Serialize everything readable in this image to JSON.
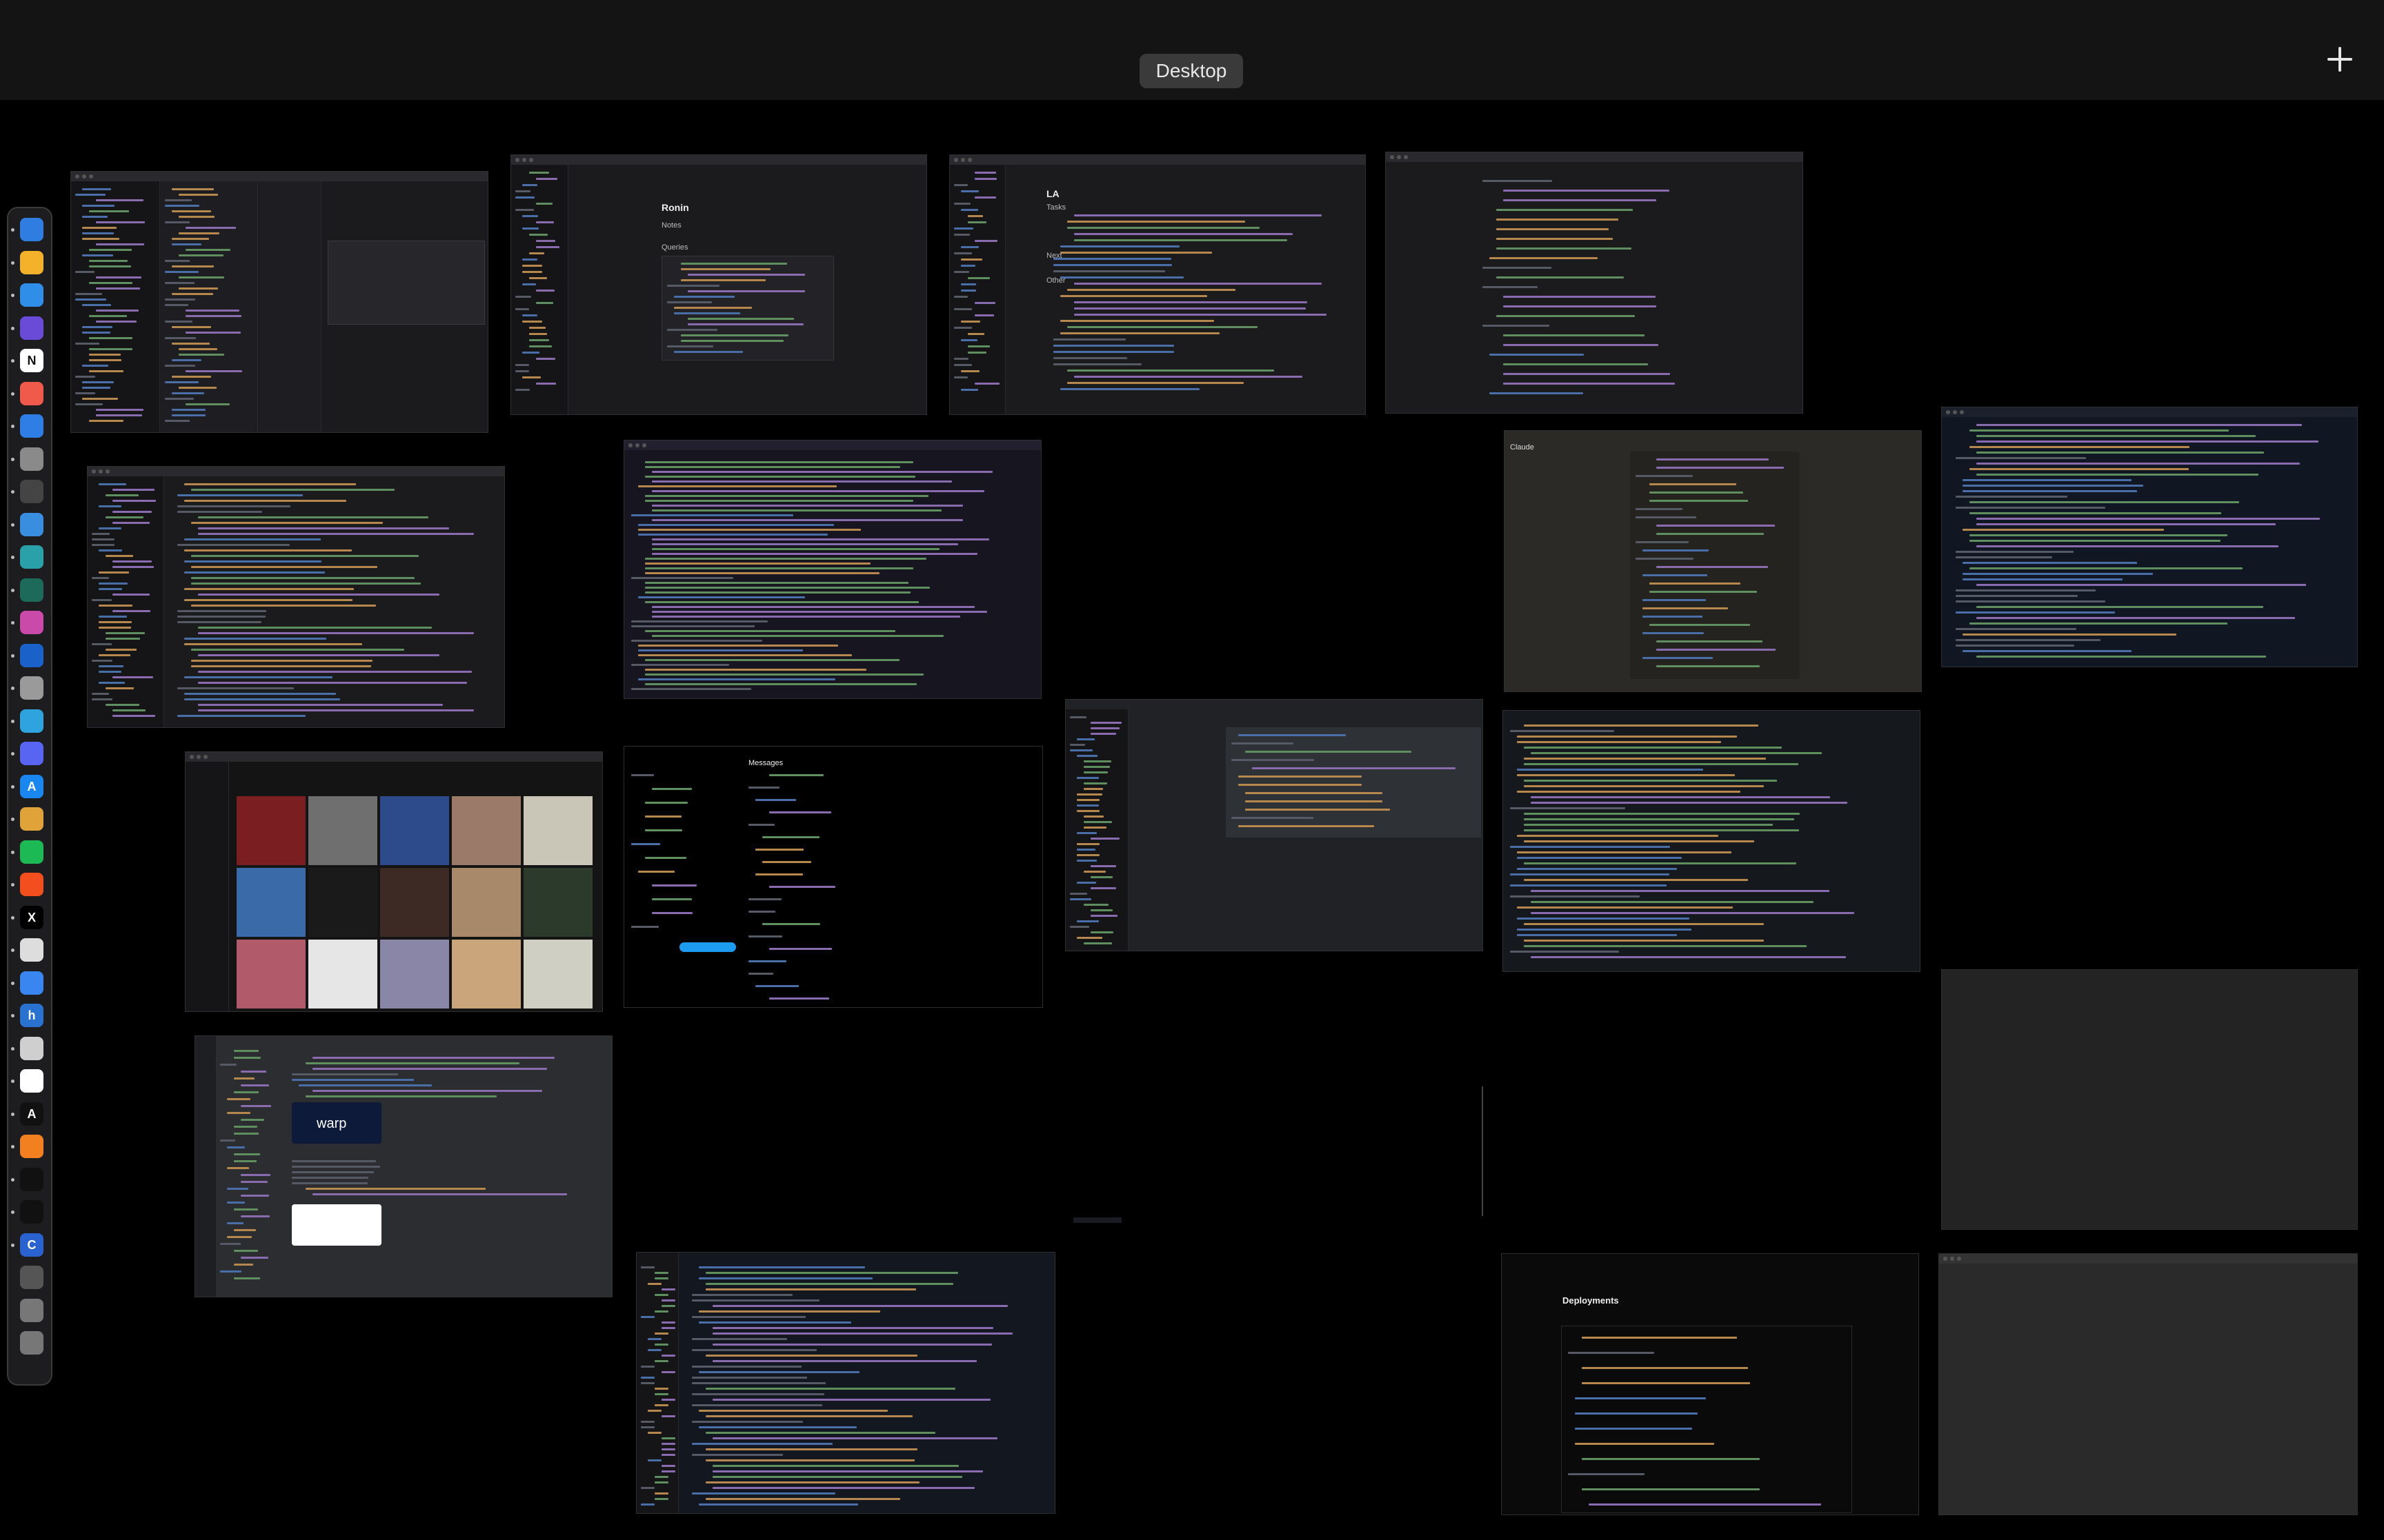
{
  "spaces": {
    "current_label": "Desktop"
  },
  "dock": {
    "apps": [
      {
        "name": "finder-icon",
        "color": "#2f7de1",
        "glyph": ""
      },
      {
        "name": "app-yellow-icon",
        "color": "#f4b12a",
        "glyph": ""
      },
      {
        "name": "safari-icon",
        "color": "#2f8fe8",
        "glyph": ""
      },
      {
        "name": "app-violet-icon",
        "color": "#6a4bd8",
        "glyph": ""
      },
      {
        "name": "notion-icon",
        "color": "#ffffff",
        "glyph": "N"
      },
      {
        "name": "calendar-icon",
        "color": "#f05a4a",
        "glyph": ""
      },
      {
        "name": "tasks-icon",
        "color": "#2e7ee6",
        "glyph": ""
      },
      {
        "name": "app-gray-icon",
        "color": "#8a8a8a",
        "glyph": ""
      },
      {
        "name": "app-box-icon",
        "color": "#444444",
        "glyph": ""
      },
      {
        "name": "app-blue-icon",
        "color": "#3a8ee0",
        "glyph": ""
      },
      {
        "name": "app-teal-icon",
        "color": "#2aa1a8",
        "glyph": ""
      },
      {
        "name": "terminal-icon",
        "color": "#1e6a5a",
        "glyph": ""
      },
      {
        "name": "app-pink-icon",
        "color": "#c94aa8",
        "glyph": ""
      },
      {
        "name": "onepassword-icon",
        "color": "#1a62c9",
        "glyph": ""
      },
      {
        "name": "preview-icon",
        "color": "#9a9a9a",
        "glyph": ""
      },
      {
        "name": "telegram-icon",
        "color": "#2ea3dd",
        "glyph": ""
      },
      {
        "name": "discord-icon",
        "color": "#5865f2",
        "glyph": ""
      },
      {
        "name": "app-store-icon",
        "color": "#1a86f0",
        "glyph": "A"
      },
      {
        "name": "slack-icon",
        "color": "#e0a33a",
        "glyph": ""
      },
      {
        "name": "spotify-icon",
        "color": "#1db954",
        "glyph": ""
      },
      {
        "name": "figma-icon",
        "color": "#f24e1e",
        "glyph": ""
      },
      {
        "name": "x-icon",
        "color": "#000000",
        "glyph": "X"
      },
      {
        "name": "app-white-icon",
        "color": "#dddddd",
        "glyph": ""
      },
      {
        "name": "chrome-icon",
        "color": "#3a86f0",
        "glyph": ""
      },
      {
        "name": "app-h-icon",
        "color": "#2a72d0",
        "glyph": "h"
      },
      {
        "name": "app-light-icon",
        "color": "#cfcfcf",
        "glyph": ""
      },
      {
        "name": "chatgpt-icon",
        "color": "#ffffff",
        "glyph": ""
      },
      {
        "name": "anthropic-icon",
        "color": "#111111",
        "glyph": "A"
      },
      {
        "name": "cloudflare-icon",
        "color": "#f38020",
        "glyph": ""
      },
      {
        "name": "app-circle-icon",
        "color": "#111111",
        "glyph": ""
      },
      {
        "name": "vercel-icon",
        "color": "#111111",
        "glyph": ""
      },
      {
        "name": "app-c-icon",
        "color": "#2a62d0",
        "glyph": "C"
      },
      {
        "name": "downloads-stack-icon",
        "color": "#555555",
        "glyph": ""
      },
      {
        "name": "phone-mirroring-icon",
        "color": "#777777",
        "glyph": ""
      },
      {
        "name": "trash-icon",
        "color": "#777777",
        "glyph": ""
      }
    ]
  },
  "windows": {
    "notes_title": "Ronin",
    "notes_h1": "Notes",
    "notes_h2": "Queries",
    "doc2_title": "LA",
    "doc2_h1": "Tasks",
    "doc2_h2": "Next",
    "doc2_h3": "Other",
    "claude_label": "Claude",
    "messages_label": "Messages",
    "warp_label": "warp",
    "deployments_label": "Deployments"
  }
}
